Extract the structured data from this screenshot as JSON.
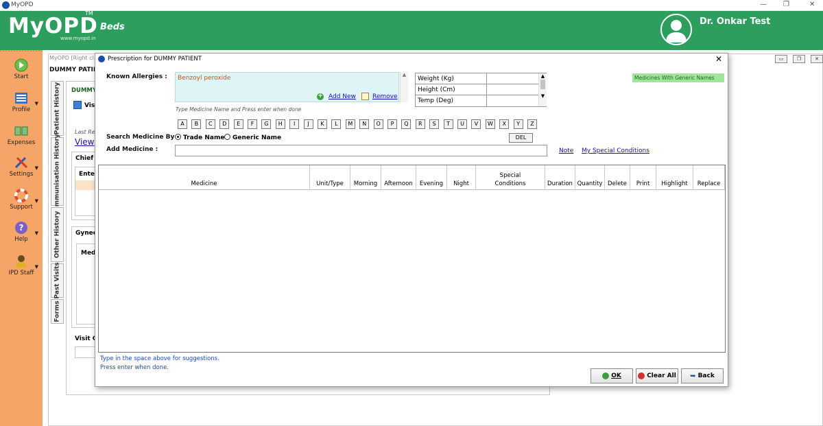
{
  "window": {
    "title": "MyOPD",
    "controls": [
      "—",
      "❐",
      "✕"
    ]
  },
  "header": {
    "logo": "MyOPD",
    "tm": "TM",
    "website": "www.myopd.in",
    "module": "Beds",
    "user_name": "Dr. Onkar Test",
    "bg_color": "#2e9e5e"
  },
  "sidebar": {
    "items": [
      {
        "label": "Start",
        "icon": "start-icon"
      },
      {
        "label": "Profile",
        "icon": "profile-icon"
      },
      {
        "label": "Expenses",
        "icon": "expenses-icon"
      },
      {
        "label": "Settings",
        "icon": "settings-icon"
      },
      {
        "label": "Support",
        "icon": "support-icon"
      },
      {
        "label": "Help",
        "icon": "help-icon"
      },
      {
        "label": "IPD Staff",
        "icon": "ipd-staff-icon"
      }
    ]
  },
  "background": {
    "window_title": "MyOPD [Right cl",
    "patient": "DUMMY PATIEN",
    "vertical_tabs": [
      "Patient History",
      "Immunisation History",
      "Other History",
      "Past Visits",
      "Forms"
    ],
    "panel_patient": "DUMMY",
    "visit_label": "Vis",
    "last_label": "Last Re",
    "view_link": "View",
    "chief": "Chief",
    "enter": "Enter",
    "gyne": "Gynec",
    "medi": "Medi",
    "visit_c": "Visit C"
  },
  "dialog": {
    "title": "Prescription for DUMMY PATIENT",
    "known_allergies_label": "Known Allergies :",
    "allergies_value": "Benzoyl peroxide",
    "add_new": "Add New",
    "remove": "Remove",
    "allergy_hint": "Type Medicine Name and Press enter when done",
    "vitals": [
      {
        "label": "Weight (Kg)",
        "value": ""
      },
      {
        "label": "Height (Cm)",
        "value": ""
      },
      {
        "label": "Temp (Deg)",
        "value": ""
      }
    ],
    "generic_names": "Medicines With Generic Names",
    "alphabet": [
      "A",
      "B",
      "C",
      "D",
      "E",
      "F",
      "G",
      "H",
      "I",
      "J",
      "K",
      "L",
      "M",
      "N",
      "O",
      "P",
      "Q",
      "R",
      "S",
      "T",
      "U",
      "V",
      "W",
      "X",
      "Y",
      "Z"
    ],
    "del_key": "DEL",
    "search_by_label": "Search Medicine By",
    "search_options": [
      {
        "label": "Trade Name",
        "selected": true
      },
      {
        "label": "Generic Name",
        "selected": false
      }
    ],
    "add_medicine_label": "Add Medicine :",
    "add_medicine_value": "",
    "note_link": "Note",
    "special_conditions_link": "My Special Conditions",
    "columns": [
      "Medicine",
      "Unit/Type",
      "Morning",
      "Afternoon",
      "Evening",
      "Night",
      "Special Conditions",
      "Duration",
      "Quantity",
      "Delete",
      "Print",
      "Highlight",
      "Replace"
    ],
    "rows": [],
    "hint_line1": "Type in the space above for suggestions.",
    "hint_line2": "Press enter when done.",
    "buttons": {
      "ok": "OK",
      "clear_all": "Clear All",
      "back": "Back"
    }
  }
}
